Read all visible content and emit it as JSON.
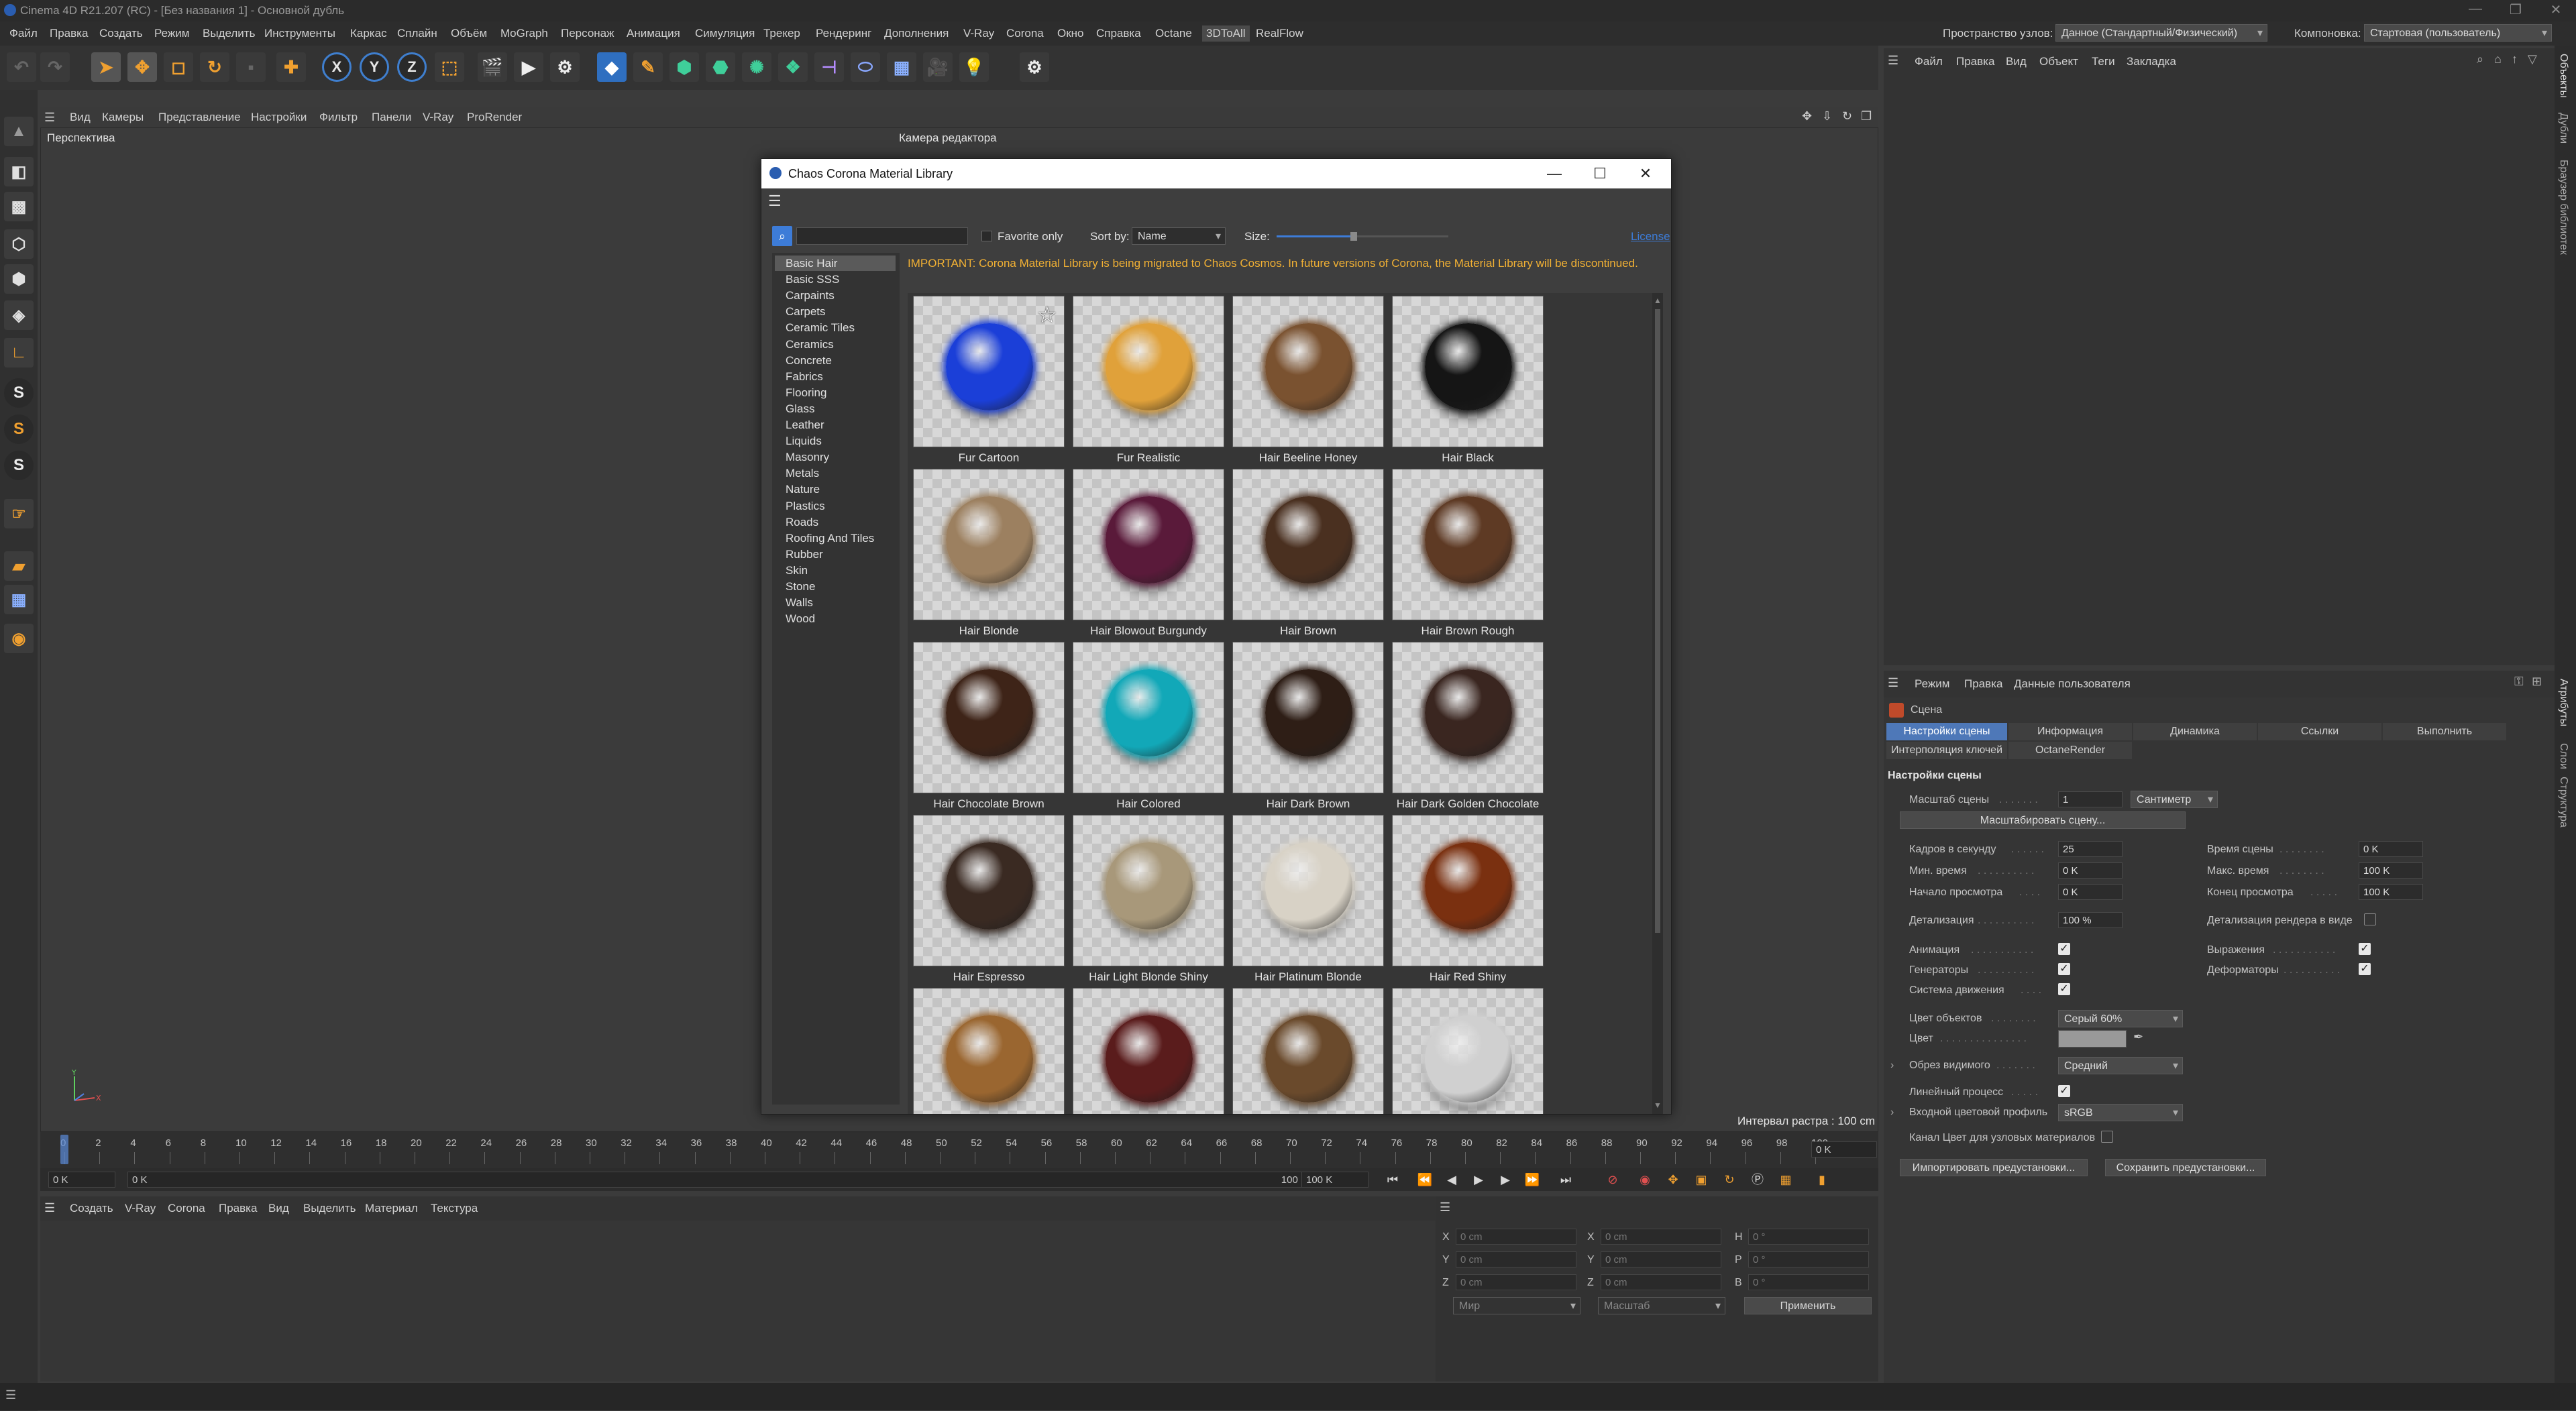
{
  "window": {
    "title": "Cinema 4D R21.207 (RC) - [Без названия 1] - Основной дубль",
    "controls": [
      "—",
      "❐",
      "✕"
    ]
  },
  "menubar": {
    "items": [
      "Файл",
      "Правка",
      "Создать",
      "Режим",
      "Выделить",
      "Инструменты",
      "Каркас",
      "Сплайн",
      "Объём",
      "MoGraph",
      "Персонаж",
      "Анимация",
      "Симуляция",
      "Трекер",
      "Рендеринг",
      "Дополнения",
      "V-Ray",
      "Corona",
      "Окно",
      "Справка",
      "Octane",
      "3DToAll",
      "RealFlow"
    ],
    "node_space_label": "Пространство узлов:",
    "node_space_value": "Данное (Стандартный/Физический)",
    "layout_label": "Компоновка:",
    "layout_value": "Стартовая (пользователь)"
  },
  "viewport": {
    "menu": [
      "Вид",
      "Камеры",
      "Представление",
      "Настройки",
      "Фильтр",
      "Панели",
      "V-Ray",
      "ProRender"
    ],
    "label": "Перспектива",
    "camera": "Камера редактора",
    "raster": "Интервал растра : 100 cm"
  },
  "timeline": {
    "ticks": [
      "0",
      "2",
      "4",
      "6",
      "8",
      "10",
      "12",
      "14",
      "16",
      "18",
      "20",
      "22",
      "24",
      "26",
      "28",
      "30",
      "32",
      "34",
      "36",
      "38",
      "40",
      "42",
      "44",
      "46",
      "48",
      "50",
      "52",
      "54",
      "56",
      "58",
      "60",
      "62",
      "64",
      "66",
      "68",
      "70",
      "72",
      "74",
      "76",
      "78",
      "80",
      "82",
      "84",
      "86",
      "88",
      "90",
      "92",
      "94",
      "96",
      "98",
      "100"
    ],
    "current_frame_field": "0 K",
    "start_field": "0 K",
    "end_label": "100 K",
    "end_field": "100 K",
    "right_field": "0 K"
  },
  "material_manager": {
    "menu": [
      "Создать",
      "V-Ray",
      "Corona",
      "Правка",
      "Вид",
      "Выделить",
      "Материал",
      "Текстура"
    ]
  },
  "coordinates": {
    "rows": [
      {
        "a": "X",
        "av": "0 cm",
        "b": "X",
        "bv": "0 cm",
        "c": "H",
        "cv": "0 °"
      },
      {
        "a": "Y",
        "av": "0 cm",
        "b": "Y",
        "bv": "0 cm",
        "c": "P",
        "cv": "0 °"
      },
      {
        "a": "Z",
        "av": "0 cm",
        "b": "Z",
        "bv": "0 cm",
        "c": "B",
        "cv": "0 °"
      }
    ],
    "mode": "Мир",
    "scale": "Масштаб",
    "apply": "Применить"
  },
  "objects_panel": {
    "menu": [
      "Файл",
      "Правка",
      "Вид",
      "Объект",
      "Теги",
      "Закладка"
    ]
  },
  "side_tabs": [
    "Объекты",
    "Дубли",
    "Браузер библиотек",
    "Атрибуты",
    "Слои",
    "Структура"
  ],
  "attributes": {
    "menu": [
      "Режим",
      "Правка",
      "Данные пользователя"
    ],
    "object": "Сцена",
    "tabs": [
      "Настройки сцены",
      "Информация",
      "Динамика",
      "Ссылки",
      "Выполнить",
      "Интерполяция ключей",
      "OctaneRender"
    ],
    "section": "Настройки сцены",
    "scale_label": "Масштаб сцены",
    "scale_value": "1",
    "scale_unit": "Сантиметр",
    "scale_button": "Масштабировать сцену...",
    "fps_label": "Кадров в секунду",
    "fps_value": "25",
    "scene_time_label": "Время сцены",
    "scene_time_value": "0 K",
    "min_time_label": "Мин. время",
    "min_time_value": "0 K",
    "max_time_label": "Макс. время",
    "max_time_value": "100 K",
    "preview_start_label": "Начало просмотра",
    "preview_start_value": "0 K",
    "preview_end_label": "Конец просмотра",
    "preview_end_value": "100 K",
    "lod_label": "Детализация",
    "lod_value": "100 %",
    "render_lod_label": "Детализация рендера в виде",
    "animation_label": "Анимация",
    "expressions_label": "Выражения",
    "generators_label": "Генераторы",
    "deformers_label": "Деформаторы",
    "motion_label": "Система движения",
    "obj_color_label": "Цвет объектов",
    "obj_color_value": "Серый 60%",
    "color_label": "Цвет",
    "clip_label": "Обрез видимого",
    "clip_value": "Средний",
    "linear_label": "Линейный процесс",
    "input_profile_label": "Входной цветовой профиль",
    "input_profile_value": "sRGB",
    "node_color_label": "Канал Цвет для узловых материалов",
    "import_btn": "Импортировать предустановки...",
    "save_btn": "Сохранить предустановки..."
  },
  "corona_dialog": {
    "title": "Chaos Corona Material Library",
    "favorite_label": "Favorite only",
    "sort_label": "Sort by:",
    "sort_value": "Name",
    "size_label": "Size:",
    "size_fraction": 0.45,
    "license_link": "License",
    "notice": "IMPORTANT: Corona Material Library is being migrated to Chaos Cosmos. In future versions of Corona, the Material Library will be discontinued.",
    "categories": [
      "Basic Hair",
      "Basic SSS",
      "Carpaints",
      "Carpets",
      "Ceramic Tiles",
      "Ceramics",
      "Concrete",
      "Fabrics",
      "Flooring",
      "Glass",
      "Leather",
      "Liquids",
      "Masonry",
      "Metals",
      "Nature",
      "Plastics",
      "Roads",
      "Roofing And Tiles",
      "Rubber",
      "Skin",
      "Stone",
      "Walls",
      "Wood"
    ],
    "selected_category": "Basic Hair",
    "materials": [
      {
        "name": "Fur Cartoon",
        "color": "#1b3fd8",
        "favorite": true
      },
      {
        "name": "Fur Realistic",
        "color": "#e0a13a"
      },
      {
        "name": "Hair Beeline Honey",
        "color": "#7a5230"
      },
      {
        "name": "Hair Black",
        "color": "#151515"
      },
      {
        "name": "Hair Blonde",
        "color": "#9c8060"
      },
      {
        "name": "Hair Blowout Burgundy",
        "color": "#5a1a3a"
      },
      {
        "name": "Hair Brown",
        "color": "#4a3020"
      },
      {
        "name": "Hair Brown Rough",
        "color": "#5e3a24"
      },
      {
        "name": "Hair Chocolate Brown",
        "color": "#3e2418"
      },
      {
        "name": "Hair Colored",
        "color": "#12a8b8"
      },
      {
        "name": "Hair Dark Brown",
        "color": "#2e1e16"
      },
      {
        "name": "Hair Dark Golden Chocolate",
        "color": "#3a2620"
      },
      {
        "name": "Hair Espresso",
        "color": "#3a2a22"
      },
      {
        "name": "Hair Light Blonde Shiny",
        "color": "#a8987a"
      },
      {
        "name": "Hair Platinum Blonde",
        "color": "#d8d2c6"
      },
      {
        "name": "Hair Red Shiny",
        "color": "#7a3010"
      },
      {
        "name": "",
        "color": "#9a6630"
      },
      {
        "name": "",
        "color": "#5a1c1c"
      },
      {
        "name": "",
        "color": "#6a4a2c"
      },
      {
        "name": "",
        "color": "#d0d0d0"
      }
    ]
  }
}
